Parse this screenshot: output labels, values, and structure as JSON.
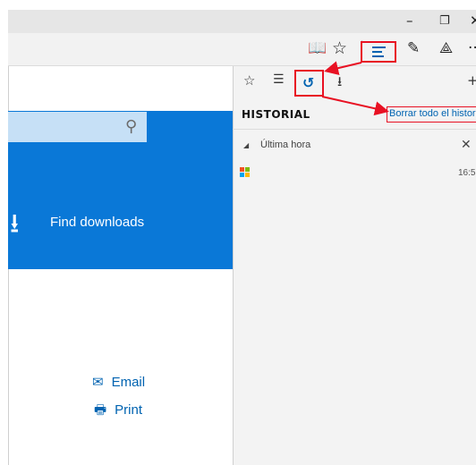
{
  "window": {
    "minimize": "–",
    "maximize": "❐",
    "close": "✕"
  },
  "toolbar": {
    "reading_view_icon": "book-open-icon",
    "favorites_icon": "star-icon",
    "hub_icon": "hub-icon",
    "web_note_icon": "pen-icon",
    "share_icon": "share-icon",
    "more_icon": "more-icon"
  },
  "page": {
    "find_downloads": "Find downloads",
    "email": "Email",
    "print": "Print"
  },
  "hub": {
    "tabs": [
      "favorites",
      "reading-list",
      "history",
      "downloads"
    ],
    "title": "HISTORIAL",
    "clear_link": "Borrar todo el historial",
    "group_label": "Última hora",
    "entry_time": "16:5",
    "accent": "#0063b1",
    "highlight": "#e81123"
  }
}
